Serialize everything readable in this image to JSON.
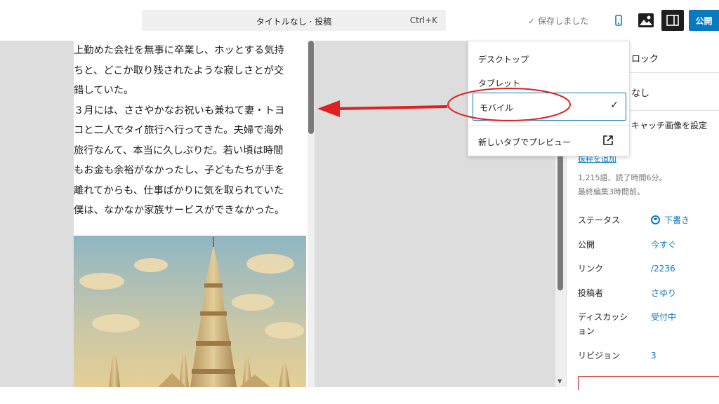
{
  "topbar": {
    "command_title": "タイトルなし · 投稿",
    "command_shortcut": "Ctrl+K",
    "saved_status": "保存しました",
    "publish_label": "公開",
    "device_icon": "mobile-icon",
    "media_icon": "image-icon",
    "panel_icon": "sidebar-toggle-icon"
  },
  "content": {
    "paragraph_lines": [
      "上勤めた会社を無事に卒業し、ホッとする気持",
      "ちと、どこか取り残されたような寂しさとが交",
      "錯していた。",
      "３月には、ささやかなお祝いも兼ねて妻・トヨ",
      "コと二人でタイ旅行へ行ってきた。夫婦で海外",
      "旅行なんて、本当に久しぶりだ。若い頃は時間",
      "もお金も余裕がなかったし、子どもたちが手を",
      "離れてからも、仕事ばかりに気を取られていた",
      "僕は、なかなか家族サービスができなかった。"
    ]
  },
  "preview_menu": {
    "items": [
      "デスクトップ",
      "タブレット",
      "モバイル"
    ],
    "selected": "モバイル",
    "open_in_new_tab": "新しいタブでプレビュー"
  },
  "sidebar": {
    "block_label_partial": "ロック",
    "title_partial": "なし",
    "featured_image_partial": "キャッチ画像を設定",
    "excerpt_link": "抜粋を追加",
    "stats": "1,215語、読了時間6分。",
    "last_edited": "最終編集3時間前。",
    "fields": [
      {
        "label": "ステータス",
        "value": "下書き"
      },
      {
        "label": "公開",
        "value": "今すぐ"
      },
      {
        "label": "リンク",
        "value": "/2236"
      },
      {
        "label": "投稿者",
        "value": "さゆり"
      },
      {
        "label": "ディスカッション",
        "value": "受付中"
      },
      {
        "label": "リビジョン",
        "value": "3"
      }
    ]
  },
  "colors": {
    "accent": "#0a7ac0",
    "annotation_red": "#e02020",
    "canvas_bg": "#dddddd"
  }
}
